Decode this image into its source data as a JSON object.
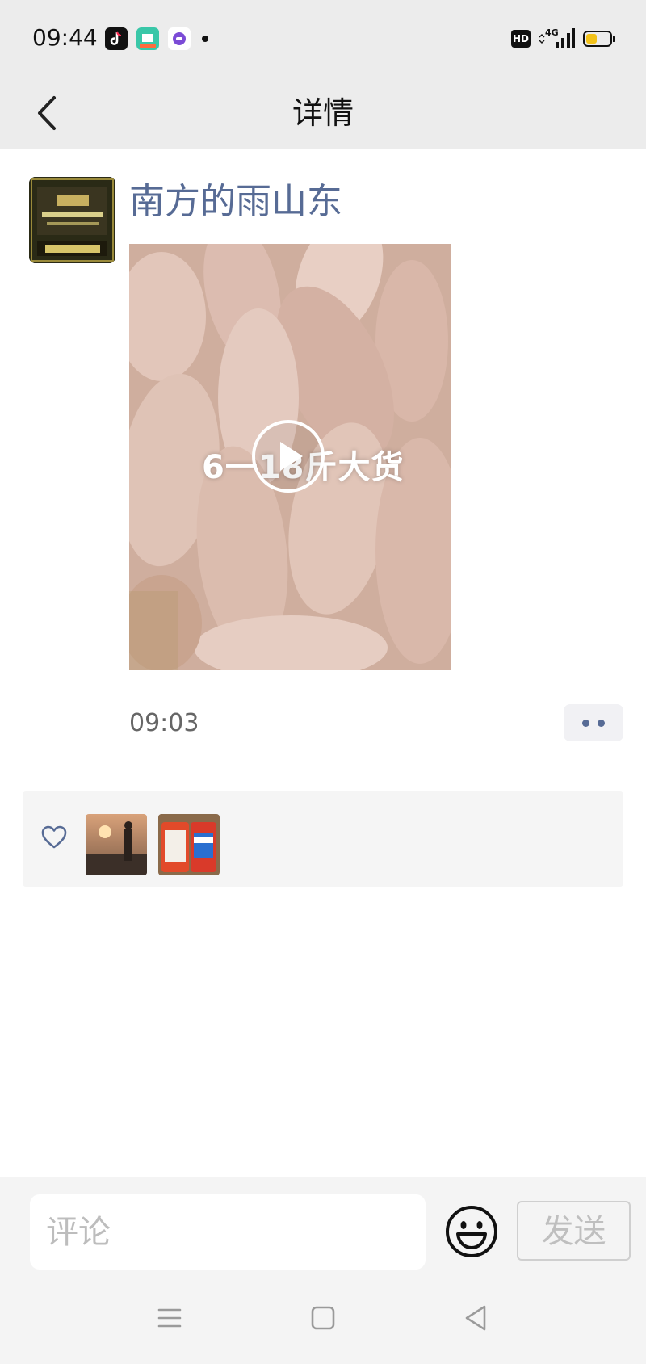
{
  "status_bar": {
    "time": "09:44",
    "app_icons": [
      "douyin-icon",
      "app-store-icon",
      "chat-bubble-icon"
    ],
    "hd_label": "HD",
    "network": "4G",
    "battery_level": 0.45,
    "colors": {
      "battery_fill": "#f2c21a"
    }
  },
  "nav": {
    "title": "详情",
    "back_icon": "chevron-left-icon"
  },
  "post": {
    "author": "南方的雨山东",
    "video_caption": "6一18斤大货",
    "time": "09:03",
    "more_icon": "two-dots-icon",
    "colors": {
      "author": "#576b95"
    }
  },
  "likes": {
    "heart_icon": "heart-icon",
    "likers": [
      "sunset-avatar",
      "cans-avatar"
    ]
  },
  "comment_bar": {
    "placeholder": "评论",
    "emoji_icon": "emoji-face-icon",
    "send_label": "发送"
  },
  "system_nav": [
    "menu-icon",
    "home-square-icon",
    "back-triangle-icon"
  ]
}
